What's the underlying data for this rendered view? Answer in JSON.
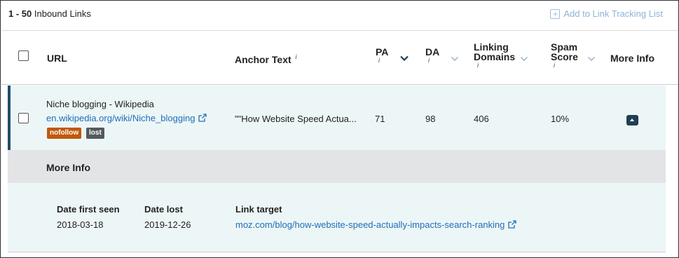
{
  "topbar": {
    "range": "1 - 50",
    "title": "Inbound Links",
    "add_tracking_label": "Add to Link Tracking List"
  },
  "columns": {
    "url": "URL",
    "anchor_text": "Anchor Text",
    "pa": "PA",
    "da": "DA",
    "linking_domains_1": "Linking",
    "linking_domains_2": "Domains",
    "spam_score_1": "Spam",
    "spam_score_2": "Score",
    "more_info": "More Info",
    "info_glyph": "i"
  },
  "row": {
    "page_title": "Niche blogging - Wikipedia",
    "url": "en.wikipedia.org/wiki/Niche_blogging",
    "badges": [
      "nofollow",
      "lost"
    ],
    "badge_colors": [
      "#c0580c",
      "#555a5e"
    ],
    "anchor_text": "\"\"How Website Speed Actua...",
    "pa": "71",
    "da": "98",
    "linking_domains": "406",
    "spam_score": "10%"
  },
  "more_info": {
    "section_title": "More Info",
    "date_first_seen_label": "Date first seen",
    "date_first_seen": "2018-03-18",
    "date_lost_label": "Date lost",
    "date_lost": "2019-12-26",
    "link_target_label": "Link target",
    "link_target": "moz.com/blog/how-website-speed-actually-impacts-search-ranking"
  },
  "colors": {
    "accent": "#1e4e6a",
    "link": "#1d6fb8",
    "row_bg": "#edf6f6",
    "more_info_bar": "#e2e4e6"
  }
}
